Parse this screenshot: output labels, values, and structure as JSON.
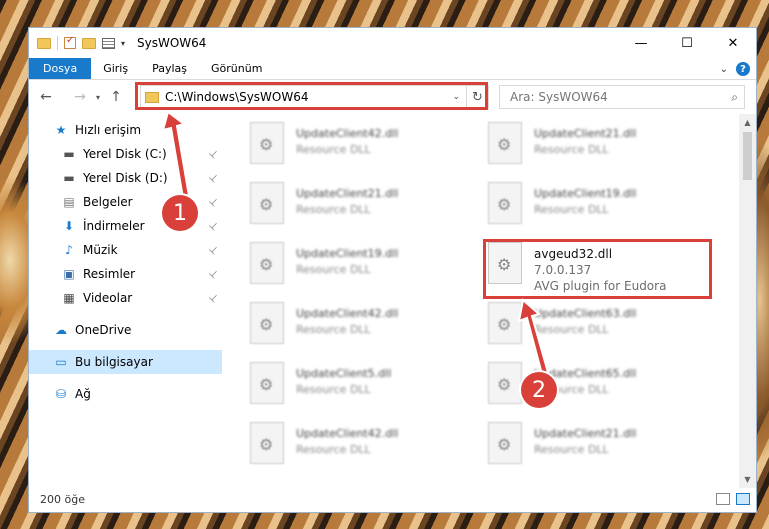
{
  "window": {
    "title": "SysWOW64",
    "controls": {
      "minimize": "—",
      "maximize": "☐",
      "close": "✕"
    }
  },
  "ribbon": {
    "tabs": [
      "Dosya",
      "Giriş",
      "Paylaş",
      "Görünüm"
    ],
    "help": "?"
  },
  "navigation": {
    "back_icon": "←",
    "forward_icon": "→",
    "recent_icon": "▾",
    "up_icon": "↑",
    "address": "C:\\Windows\\SysWOW64",
    "refresh_icon": "↻",
    "search_placeholder": "Ara: SysWOW64"
  },
  "sidebar": {
    "items": [
      {
        "label": "Hızlı erişim",
        "icon": "star-icon",
        "glyph": "★",
        "pinned": false
      },
      {
        "label": "Yerel Disk (C:)",
        "icon": "drive-icon",
        "glyph": "▬",
        "pinned": true
      },
      {
        "label": "Yerel Disk (D:)",
        "icon": "drive-icon",
        "glyph": "▬",
        "pinned": true
      },
      {
        "label": "Belgeler",
        "icon": "documents-icon",
        "glyph": "▤",
        "pinned": true
      },
      {
        "label": "İndirmeler",
        "icon": "downloads-icon",
        "glyph": "⬇",
        "pinned": true
      },
      {
        "label": "Müzik",
        "icon": "music-icon",
        "glyph": "♪",
        "pinned": true
      },
      {
        "label": "Resimler",
        "icon": "pictures-icon",
        "glyph": "▣",
        "pinned": true
      },
      {
        "label": "Videolar",
        "icon": "videos-icon",
        "glyph": "▦",
        "pinned": true
      },
      {
        "label": "OneDrive",
        "icon": "onedrive-icon",
        "glyph": "☁",
        "pinned": false
      },
      {
        "label": "Bu bilgisayar",
        "icon": "computer-icon",
        "glyph": "▭",
        "pinned": false
      },
      {
        "label": "Ağ",
        "icon": "network-icon",
        "glyph": "⛁",
        "pinned": false
      }
    ],
    "pin_glyph": "📌"
  },
  "files": [
    {
      "name": "UpdateClient42.dll",
      "sub": "Resource DLL"
    },
    {
      "name": "UpdateClient21.dll",
      "sub": "Resource DLL"
    },
    {
      "name": "UpdateClient21.dll",
      "sub": "Resource DLL"
    },
    {
      "name": "UpdateClient19.dll",
      "sub": "Resource DLL"
    },
    {
      "name": "UpdateClient19.dll",
      "sub": "Resource DLL"
    },
    {
      "name": "avgeud32.dll",
      "sub": "7.0.0.137",
      "sub2": "AVG plugin for Eudora"
    },
    {
      "name": "UpdateClient42.dll",
      "sub": "Resource DLL"
    },
    {
      "name": "UpdateClient63.dll",
      "sub": "Resource DLL"
    },
    {
      "name": "UpdateClient5.dll",
      "sub": "Resource DLL"
    },
    {
      "name": "UpdateClient65.dll",
      "sub": "Resource DLL"
    },
    {
      "name": "UpdateClient42.dll",
      "sub": "Resource DLL"
    },
    {
      "name": "UpdateClient21.dll",
      "sub": "Resource DLL"
    }
  ],
  "status": {
    "count": "200 öğe"
  },
  "annotations": {
    "badge1": "1",
    "badge2": "2",
    "color": "#d9403a"
  }
}
